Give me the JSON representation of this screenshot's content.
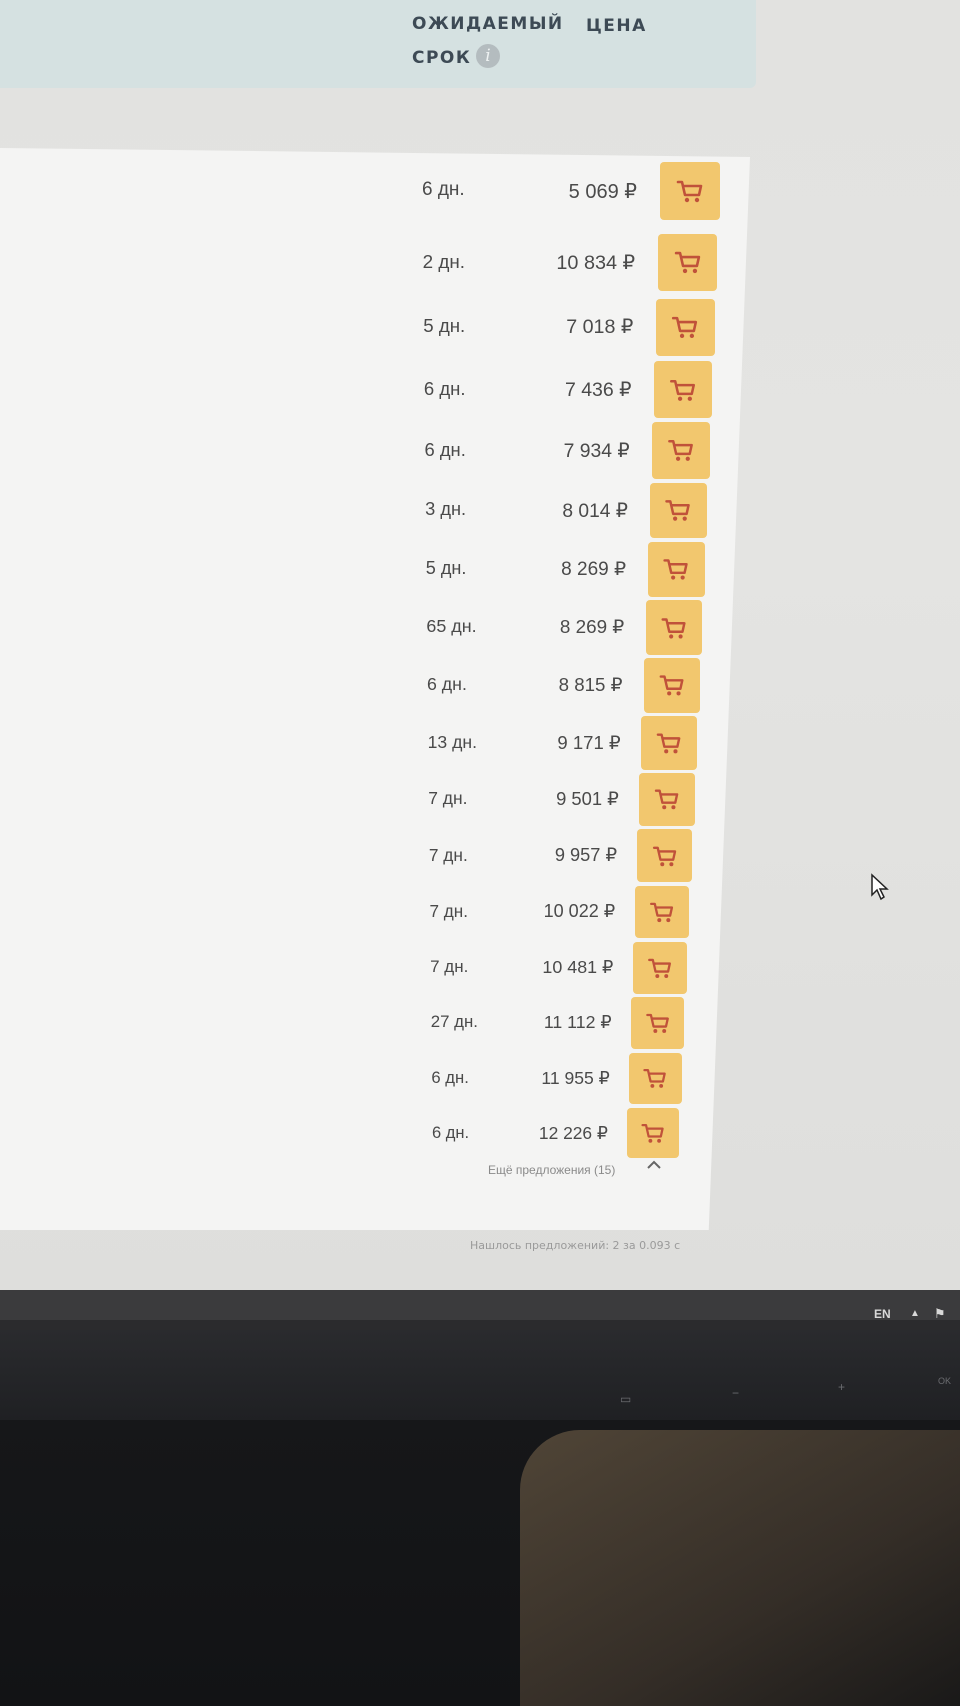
{
  "header": {
    "col_expected_line1": "ОЖИДАЕМЫЙ",
    "col_expected_line2": "СРОК",
    "col_price": "ЦЕНА",
    "info_glyph": "i"
  },
  "offers": [
    {
      "days": "6 дн.",
      "price": "5 069 ₽"
    },
    {
      "days": "2 дн.",
      "price": "10 834 ₽"
    },
    {
      "days": "5 дн.",
      "price": "7 018 ₽"
    },
    {
      "days": "6 дн.",
      "price": "7 436 ₽"
    },
    {
      "days": "6 дн.",
      "price": "7 934 ₽"
    },
    {
      "days": "3 дн.",
      "price": "8 014 ₽"
    },
    {
      "days": "5 дн.",
      "price": "8 269 ₽"
    },
    {
      "days": "65 дн.",
      "price": "8 269 ₽"
    },
    {
      "days": "6 дн.",
      "price": "8 815 ₽"
    },
    {
      "days": "13 дн.",
      "price": "9 171 ₽"
    },
    {
      "days": "7 дн.",
      "price": "9 501 ₽"
    },
    {
      "days": "7 дн.",
      "price": "9 957 ₽"
    },
    {
      "days": "7 дн.",
      "price": "10 022 ₽"
    },
    {
      "days": "7 дн.",
      "price": "10 481 ₽"
    },
    {
      "days": "27 дн.",
      "price": "11 112 ₽"
    },
    {
      "days": "6 дн.",
      "price": "11 955 ₽"
    },
    {
      "days": "6 дн.",
      "price": "12 226 ₽"
    }
  ],
  "more_offers": "Ещё предложения (15)",
  "found_status": "Нашлось предложений: 2 за 0.093 с",
  "taskbar": {
    "language": "EN"
  },
  "monitor_buttons": [
    "−",
    "+",
    "OK"
  ],
  "colors": {
    "cart_button": "#f2c76e",
    "cart_icon": "#c0523a",
    "header_bar": "#d5e1e1"
  },
  "icons": {
    "cart": "shopping-cart-icon",
    "info": "info-icon",
    "collapse": "chevron-up-icon"
  }
}
